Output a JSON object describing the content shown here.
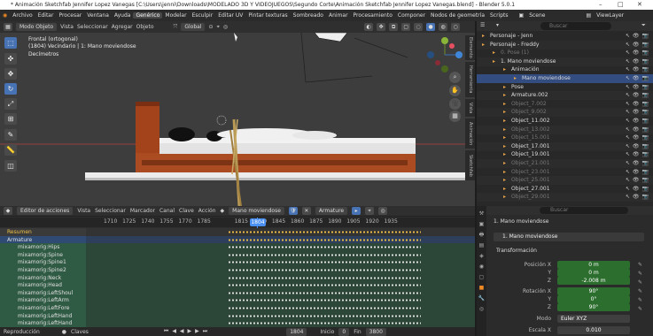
{
  "title": "* Animación Sketchfab Jennifer Lopez Vanegas [C:\\Users\\jenni\\Downloads\\MODELADO 3D Y VIDEOJUEGOS\\Segundo Corte\\Animación Sketchfab Jennifer Lopez Vanegas.blend] - Blender 5.0.1",
  "menu": [
    "Archivo",
    "Editar",
    "Procesar",
    "Ventana",
    "Ayuda"
  ],
  "workspaces": [
    "Genérico",
    "Modelar",
    "Esculpir",
    "Editar UV",
    "Pintar texturas",
    "Sombreado",
    "Animar",
    "Procesamiento",
    "Componer",
    "Nodos de geometría",
    "Scripts"
  ],
  "scene_label": "Scene",
  "viewlayer_label": "ViewLayer",
  "viewport": {
    "mode": "Modo Objeto",
    "menus": [
      "Vista",
      "Seleccionar",
      "Agregar",
      "Objeto"
    ],
    "orientation": "Global",
    "view_name": "Frontal (ortogonal)",
    "info": "(1804) Vecindario | 1: Mano moviendose",
    "units": "Decímetros"
  },
  "sidetabs": [
    "Elemento",
    "Herramienta",
    "Vista",
    "Animación",
    "Sketchfab"
  ],
  "outliner": {
    "search_placeholder": "Buscar",
    "rows": [
      {
        "name": "Personaje - Jenn",
        "indent": 6
      },
      {
        "name": "Personaje - Freddy",
        "indent": 6
      },
      {
        "name": "0. Pose (1)",
        "indent": 18,
        "dim": true
      },
      {
        "name": "1. Mano moviendose",
        "indent": 18
      },
      {
        "name": "Animación",
        "indent": 30
      },
      {
        "name": "Mano moviendose",
        "indent": 42,
        "sel": true
      },
      {
        "name": "Pose",
        "indent": 30
      },
      {
        "name": "Armature.002",
        "indent": 30
      },
      {
        "name": "Object_7.002",
        "indent": 30,
        "dim": true
      },
      {
        "name": "Object_9.002",
        "indent": 30,
        "dim": true
      },
      {
        "name": "Object_11.002",
        "indent": 30
      },
      {
        "name": "Object_13.002",
        "indent": 30,
        "dim": true
      },
      {
        "name": "Object_15.001",
        "indent": 30,
        "dim": true
      },
      {
        "name": "Object_17.001",
        "indent": 30
      },
      {
        "name": "Object_19.001",
        "indent": 30
      },
      {
        "name": "Object_21.001",
        "indent": 30,
        "dim": true
      },
      {
        "name": "Object_23.001",
        "indent": 30,
        "dim": true
      },
      {
        "name": "Object_25.001",
        "indent": 30,
        "dim": true
      },
      {
        "name": "Object_27.001",
        "indent": 30
      },
      {
        "name": "Object_29.001",
        "indent": 30,
        "dim": true
      }
    ]
  },
  "properties": {
    "search_placeholder": "Buscar",
    "object_name": "1. Mano moviendose",
    "object_field": "1. Mano moviendose",
    "section": "Transformación",
    "location_label": "Posición X",
    "rotation_label": "Rotación X",
    "mode_label": "Modo",
    "scale_label": "Escala X",
    "location": [
      "0 m",
      "0 m",
      "-2.008 m"
    ],
    "rotation": [
      "90°",
      "0°",
      "90°"
    ],
    "mode": "Euler XYZ",
    "scale": "0.010",
    "axes": [
      "Y",
      "Z"
    ]
  },
  "dopesheet": {
    "editor": "Editor de acciones",
    "menus": [
      "Vista",
      "Seleccionar",
      "Marcador",
      "Canal",
      "Clave",
      "Acción"
    ],
    "action": "Mano moviendose",
    "armature": "Armature",
    "frames": [
      "1710",
      "1725",
      "1740",
      "1755",
      "1770",
      "1785",
      "1804",
      "1815",
      "1830",
      "1845",
      "1860",
      "1875",
      "1890",
      "1905",
      "1920",
      "1935"
    ],
    "current_frame": "1804",
    "channels": [
      "Resumen",
      "Armature",
      "mixamorig:Hips",
      "mixamorig:Spine",
      "mixamorig:Spine1",
      "mixamorig:Spine2",
      "mixamorig:Neck",
      "mixamorig:Head",
      "mixamorig:LeftShoul",
      "mixamorig:LeftArm",
      "mixamorig:LeftFore",
      "mixamorig:LeftHand",
      "mixamorig:LeftHand"
    ]
  },
  "footer": {
    "playback": "Reproducción",
    "keys": "Claves",
    "frame": "1804",
    "start_label": "Inicio",
    "start": "0",
    "end_label": "Fin",
    "end": "3800"
  }
}
